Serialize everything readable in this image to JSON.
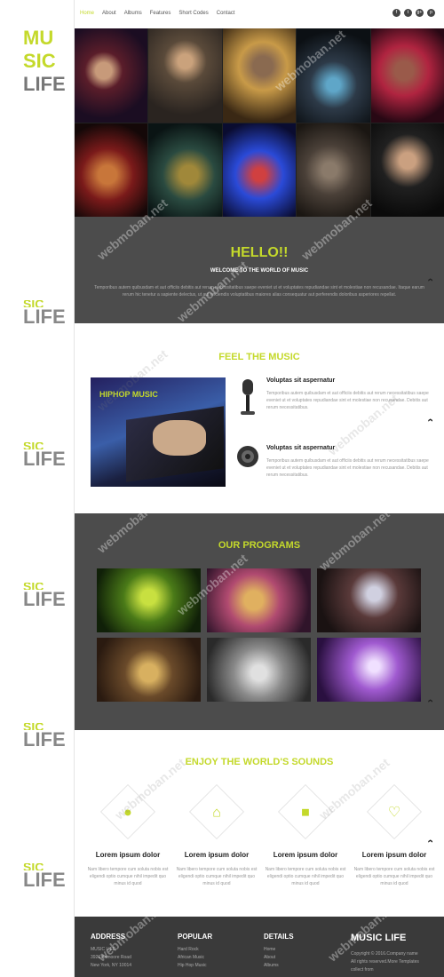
{
  "brand": {
    "line1": "MU",
    "line2": "SIC",
    "line3": "LIFE",
    "ghost_top": "SIC",
    "ghost_bottom": "LIFE"
  },
  "nav": {
    "items": [
      "Home",
      "About",
      "Albums",
      "Features",
      "Short Codes",
      "Contact"
    ],
    "active": "Home"
  },
  "social": [
    "f",
    "t",
    "g+",
    "p"
  ],
  "hello": {
    "title": "HELLO!!",
    "subtitle": "WELCOME TO THE WORLD OF MUSIC",
    "text": "Temporibus autem quibusdam et aut officiis debitis aut rerum necessitatibus saepe eveniet ut et voluptates repudiandae sint et molestiae non recusandae. Itaque earum rerum hic tenetur a sapiente delectus, ut aut reiciendis voluptatibus maiores alias consequatur aut perferendis doloribus asperiores repellat."
  },
  "feel": {
    "title": "FEEL THE MUSIC",
    "image_label": "HIPHOP MUSIC",
    "features": [
      {
        "title": "Voluptas sit aspernatur",
        "text": "Temporibus autem quibusdam et aut officiis debitis aut rerum necessitatibus saepe eveniet ut et voluptates repudiandae sint et molestiae non recusandae. Debitis aut rerum necessitatibus."
      },
      {
        "title": "Voluptas sit aspernatur",
        "text": "Temporibus autem quibusdam et aut officiis debitis aut rerum necessitatibus saepe eveniet ut et voluptates repudiandae sint et molestiae non recusandae. Debitis aut rerum necessitatibus."
      }
    ]
  },
  "programs": {
    "title": "OUR PROGRAMS"
  },
  "sounds": {
    "title": "ENJOY THE WORLD'S SOUNDS",
    "cards": [
      {
        "icon": "user-icon",
        "glyph": "●",
        "title": "Lorem ipsum dolor",
        "text": "Nam libero tempore cum soluta nobis est eligendi optio cumque nihil impedit quo minus id quod"
      },
      {
        "icon": "home-icon",
        "glyph": "⌂",
        "title": "Lorem ipsum dolor",
        "text": "Nam libero tempore cum soluta nobis est eligendi optio cumque nihil impedit quo minus id quod"
      },
      {
        "icon": "video-icon",
        "glyph": "■",
        "title": "Lorem ipsum dolor",
        "text": "Nam libero tempore cum soluta nobis est eligendi optio cumque nihil impedit quo minus id quod"
      },
      {
        "icon": "heart-icon",
        "glyph": "♡",
        "title": "Lorem ipsum dolor",
        "text": "Nam libero tempore cum soluta nobis est eligendi optio cumque nihil impedit quo minus id quod"
      }
    ]
  },
  "footer": {
    "address": {
      "title": "ADDRESS",
      "lines": [
        "MUSIC LIFE",
        "3926 Anmoore Road",
        "New York, NY 10014"
      ]
    },
    "popular": {
      "title": "POPULAR",
      "lines": [
        "Hard Rock",
        "African Music",
        "Hip Hop Music"
      ]
    },
    "details": {
      "title": "DETAILS",
      "lines": [
        "Home",
        "About",
        "Albums"
      ]
    },
    "brand": {
      "title": "MUSIC LIFE",
      "lines": [
        "Copyright © 2016.Company name",
        "All rights reserved.More Templates",
        "collect from"
      ]
    }
  },
  "watermark": "webmoban.net",
  "colors": {
    "accent": "#c4d92b",
    "dark": "#4c4c4c",
    "footer": "#3a3a3a"
  }
}
